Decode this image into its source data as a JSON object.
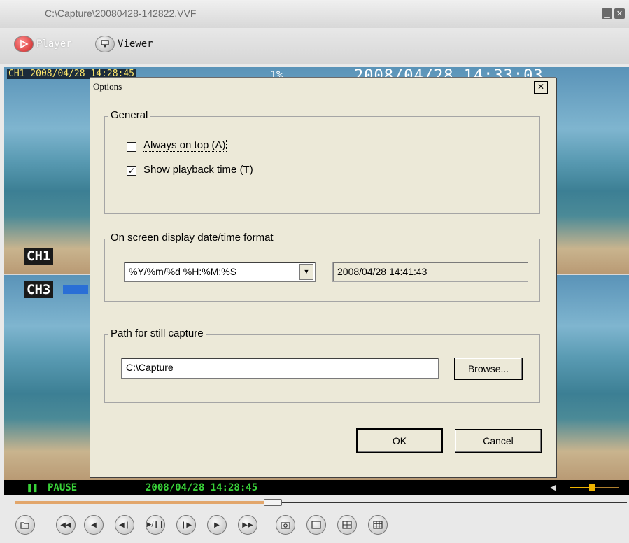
{
  "window": {
    "title": "C:\\Capture\\20080428-142822.VVF",
    "minimize_icon": "minimize-icon",
    "close_icon": "close-icon"
  },
  "modes": {
    "player_label": "Player",
    "viewer_label": "Viewer",
    "player_color": "#d22c2c"
  },
  "video": {
    "osd_top_left": "CH1 2008/04/28 14:28:45",
    "osd_percent": "1%",
    "osd_top_right": "2008/04/28 14:33:03",
    "ch1_label": "CH1",
    "ch3_label": "CH3"
  },
  "status": {
    "pause_label": "PAUSE",
    "timestamp": "2008/04/28 14:28:45",
    "color": "#39d339"
  },
  "seek": {
    "progress": 0.42
  },
  "volume": {
    "level": 0.45,
    "color": "#f0b400"
  },
  "controls": [
    "open-file-icon",
    "rewind-fast-icon",
    "step-back-icon",
    "frame-back-icon",
    "play-pause-icon",
    "frame-forward-icon",
    "step-forward-icon",
    "forward-fast-icon",
    "snapshot-icon",
    "layout-single-icon",
    "layout-quad-icon",
    "layout-nine-icon"
  ],
  "dialog": {
    "title": "Options",
    "close_symbol": "✕",
    "general": {
      "legend": "General",
      "always_on_top": {
        "label": "Always on top (A)",
        "checked": false
      },
      "show_playback_time": {
        "label": "Show playback time (T)",
        "checked": true
      }
    },
    "osd_format": {
      "legend": "On screen display date/time format",
      "selected_format": "%Y/%m/%d %H:%M:%S",
      "preview": "2008/04/28 14:41:43"
    },
    "still_capture": {
      "legend": "Path for still capture",
      "path": "C:\\Capture",
      "browse_label": "Browse..."
    },
    "ok_label": "OK",
    "cancel_label": "Cancel"
  }
}
